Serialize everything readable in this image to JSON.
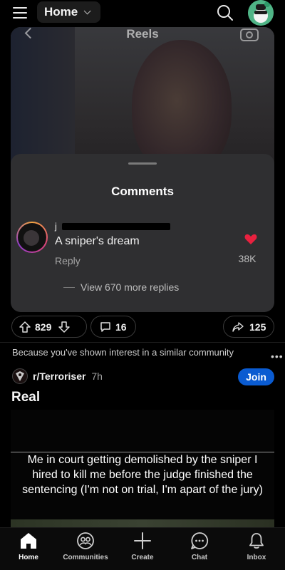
{
  "header": {
    "feed_label": "Home"
  },
  "reel": {
    "title": "Reels"
  },
  "comments": {
    "title": "Comments",
    "username": "j",
    "text": "A sniper's dream",
    "reply_label": "Reply",
    "like_count": "38K",
    "view_replies": "View 670 more replies"
  },
  "post_actions": {
    "upvotes": "829",
    "comments": "16",
    "shares": "125"
  },
  "recommendation": {
    "reason": "Because you've shown interest in a similar community",
    "subreddit": "r/Terroriser",
    "age": "7h",
    "join_label": "Join",
    "post_title": "Real",
    "meme_caption": "Me in court getting demolished by the sniper I hired to kill me before the judge finished the sentencing (I'm not on trial, I'm apart of the jury)"
  },
  "bottom_nav": {
    "items": [
      {
        "label": "Home",
        "icon": "home-icon",
        "active": true
      },
      {
        "label": "Communities",
        "icon": "communities-icon"
      },
      {
        "label": "Create",
        "icon": "plus-icon"
      },
      {
        "label": "Chat",
        "icon": "chat-icon"
      },
      {
        "label": "Inbox",
        "icon": "bell-icon"
      }
    ]
  },
  "colors": {
    "background": "#000000",
    "join_button": "#0a5bd1",
    "heart": "#e8213f",
    "sheet": "#2f2f31"
  }
}
